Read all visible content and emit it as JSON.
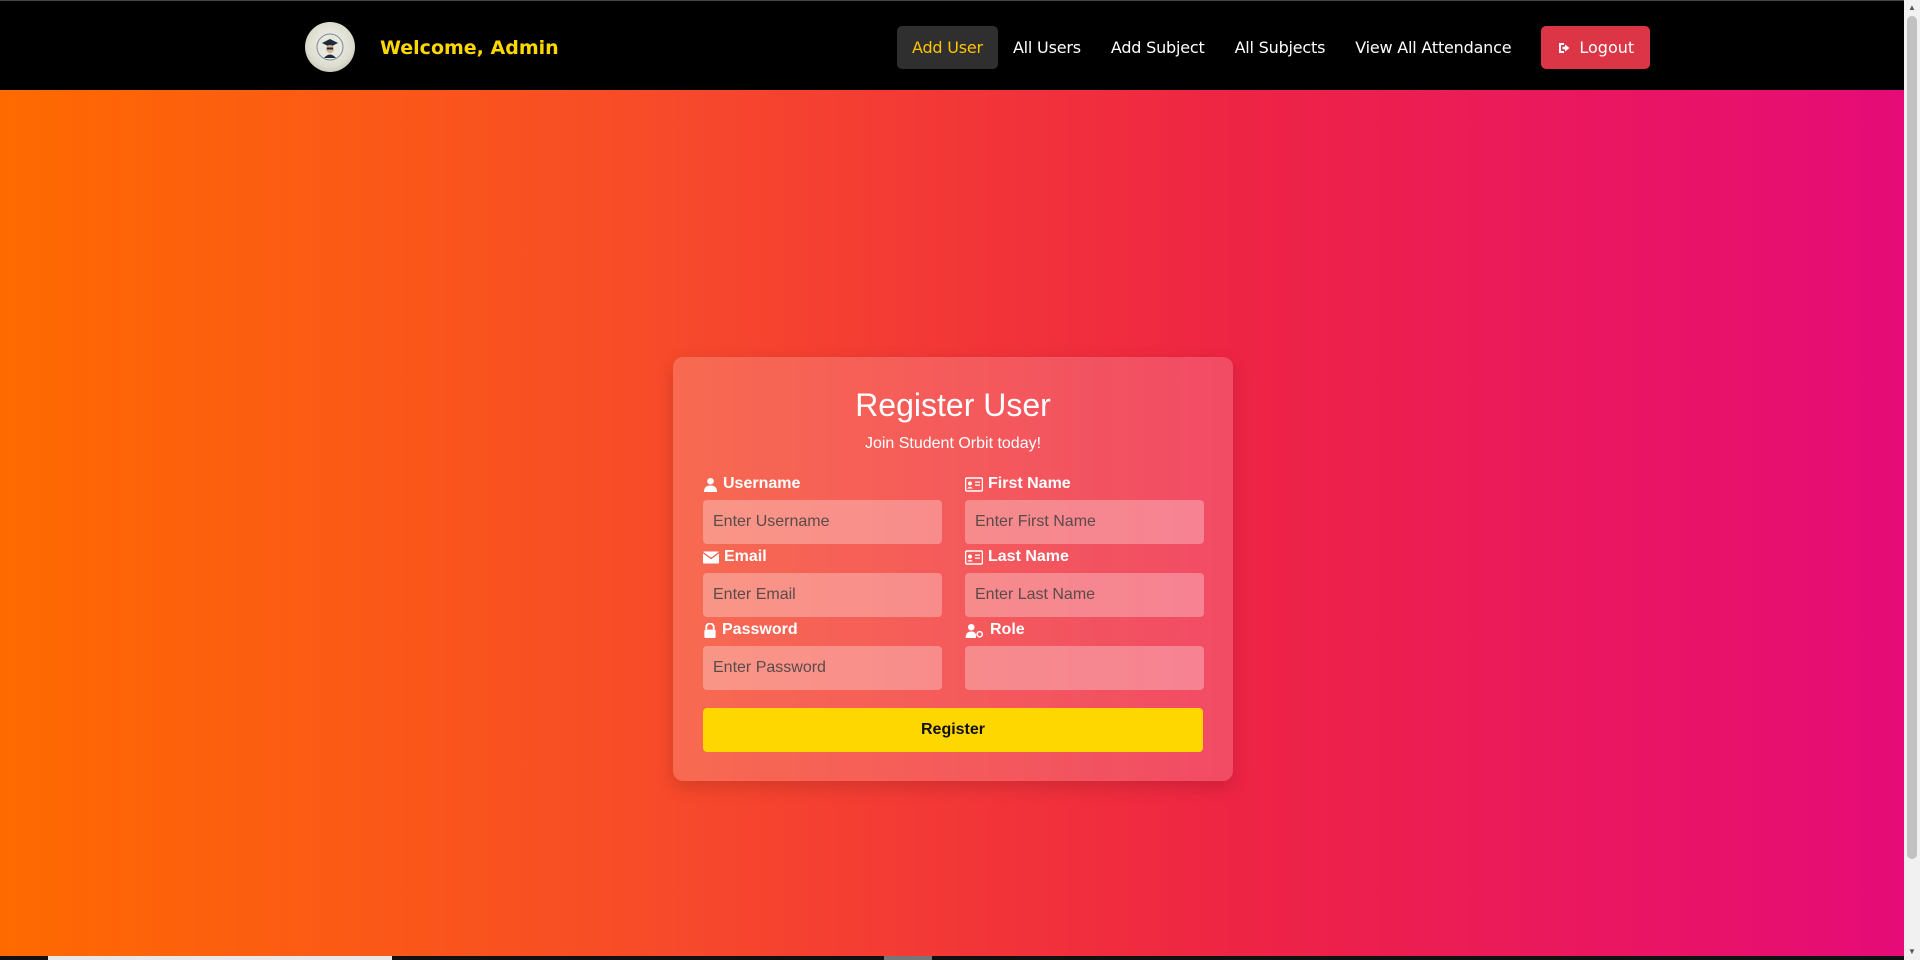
{
  "header": {
    "welcome": "Welcome, Admin",
    "nav": [
      {
        "label": "Add User",
        "active": true
      },
      {
        "label": "All Users",
        "active": false
      },
      {
        "label": "Add Subject",
        "active": false
      },
      {
        "label": "All Subjects",
        "active": false
      },
      {
        "label": "View All Attendance",
        "active": false
      }
    ],
    "logout_label": "Logout"
  },
  "form": {
    "title": "Register User",
    "subtitle": "Join Student Orbit today!",
    "fields": {
      "username": {
        "label": "Username",
        "placeholder": "Enter Username",
        "icon": "user-icon"
      },
      "first_name": {
        "label": "First Name",
        "placeholder": "Enter First Name",
        "icon": "id-card-icon"
      },
      "email": {
        "label": "Email",
        "placeholder": "Enter Email",
        "icon": "envelope-icon"
      },
      "last_name": {
        "label": "Last Name",
        "placeholder": "Enter Last Name",
        "icon": "id-card-icon"
      },
      "password": {
        "label": "Password",
        "placeholder": "Enter Password",
        "icon": "lock-icon"
      },
      "role": {
        "label": "Role",
        "placeholder": "",
        "icon": "user-key-icon"
      }
    },
    "submit_label": "Register"
  },
  "colors": {
    "accent": "#ffd700",
    "logout": "#dc3545",
    "navbar": "#000000",
    "gradient_start": "#ff6a00",
    "gradient_end": "#e60b78"
  }
}
